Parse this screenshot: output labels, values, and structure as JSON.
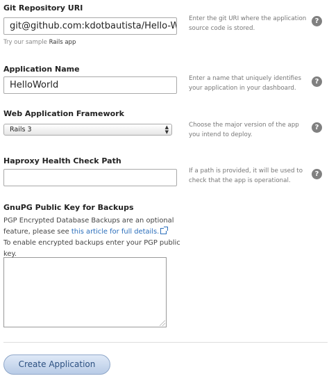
{
  "git": {
    "label": "Git Repository URI",
    "value": "git@github.com:kdotbautista/Hello-W",
    "help": "Enter the git URI where the application source code is stored.",
    "sample_prefix": "Try our sample ",
    "sample_link": "Rails app"
  },
  "app_name": {
    "label": "Application Name",
    "value": "HelloWorld",
    "help": "Enter a name that uniquely identifies your application in your dashboard."
  },
  "framework": {
    "label": "Web Application Framework",
    "selected": "Rails 3",
    "help": "Choose the major version of the app you intend to deploy."
  },
  "haproxy": {
    "label": "Haproxy Health Check Path",
    "value": "",
    "help": "If a path is provided, it will be used to check that the app is operational."
  },
  "gpg": {
    "label": "GnuPG Public Key for Backups",
    "text_before": "PGP Encrypted Database Backups are an optional feature, please see ",
    "article_link": "this article for full details.",
    "text_after": "To enable encrypted backups enter your PGP public key.",
    "value": ""
  },
  "help_icon_glyph": "?",
  "submit_label": "Create Application",
  "colors": {
    "link": "#2a6ebb",
    "button_text": "#2b4f80",
    "help_icon": "#808080"
  }
}
